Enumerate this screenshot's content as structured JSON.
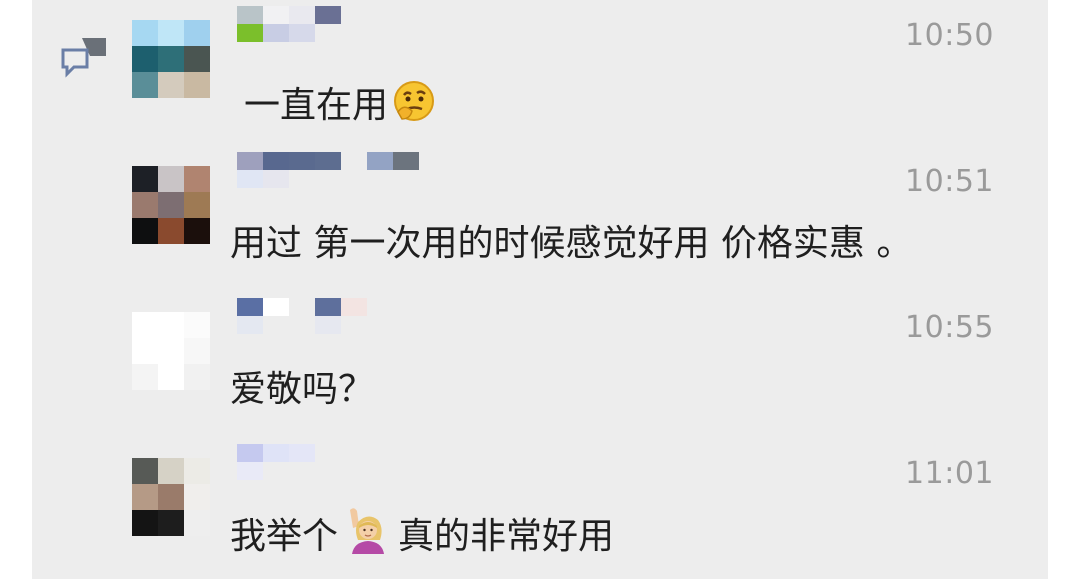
{
  "chat": {
    "messages": [
      {
        "time": "10:50",
        "text": "一直在用",
        "emoji": "thinking-face-emoji",
        "avatar_colors": [
          "#a6d8f2",
          "#bfe6f7",
          "#9fd0ee",
          "#1d5f6e",
          "#2e6f78",
          "#4a5551",
          "#5a8e98",
          "#d4cbbd",
          "#c9b9a2"
        ],
        "nick_colors": [
          "#b9c4c8",
          "#7bbf2b",
          "#f1f1f3",
          "#c8cde4",
          "#e9e9ef",
          "#d6d9ea",
          "#6a7094",
          "#ededed"
        ]
      },
      {
        "time": "10:51",
        "text": "用过 第一次用的时候感觉好用 价格实惠 。",
        "avatar_colors": [
          "#1d2026",
          "#c9c4c6",
          "#b08470",
          "#9a7a6e",
          "#7d6e72",
          "#9e7a54",
          "#0e0f10",
          "#8a4a2e",
          "#1b0f0c"
        ],
        "nick_colors": [
          "#9ea0bd",
          "#e0e6f4",
          "#58688f",
          "#e6e6ee",
          "#5a6a8f",
          "#ededed",
          "#5d6d90",
          "#ededed",
          "#ededed",
          "#ededed",
          "#93a3c4",
          "#ededed",
          "#6c747e",
          "#ededed"
        ]
      },
      {
        "time": "10:55",
        "text": "爱敬吗？",
        "avatar_colors": [
          "#ffffff",
          "#ffffff",
          "#fbfbfb",
          "#ffffff",
          "#ffffff",
          "#f7f7f7",
          "#f4f4f4",
          "#ffffff",
          "#f1f1f1"
        ],
        "nick_colors": [
          "#5a6fa4",
          "#e4e8f1",
          "#ffffff",
          "#ededed",
          "#ededed",
          "#ededed",
          "#5e6f9c",
          "#e6e8f0",
          "#f3e4e2",
          "#ededed"
        ]
      },
      {
        "time": "11:01",
        "text": "我举个",
        "emoji": "woman-raising-hand-emoji",
        "text_after": "真的非常好用",
        "avatar_colors": [
          "#575a56",
          "#d6d2c6",
          "#ecebe6",
          "#b59a86",
          "#9a7b6a",
          "#f0eeec",
          "#141414",
          "#1d1d1d",
          "#eeeeee"
        ],
        "nick_colors": [
          "#c5c9ef",
          "#e9eaf7",
          "#dfe3f7",
          "#ededed",
          "#e4e6f7",
          "#ededed"
        ]
      }
    ]
  }
}
